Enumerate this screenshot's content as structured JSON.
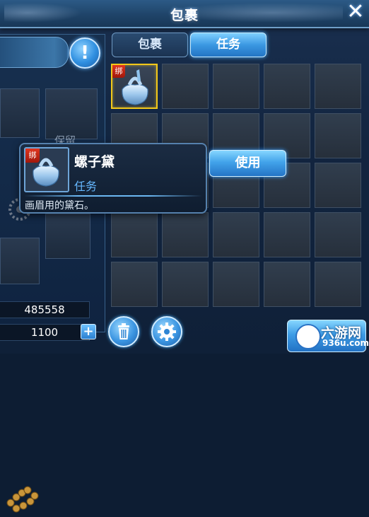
{
  "window": {
    "title": "包裹",
    "close_glyph": "✕"
  },
  "tabs": [
    {
      "label": "包裹",
      "active": false
    },
    {
      "label": "任务",
      "active": true
    }
  ],
  "left_panel": {
    "info_glyph": "!",
    "equip_label": "保留",
    "gold": "485558",
    "gems": "1100",
    "add_glyph": "+"
  },
  "inventory": {
    "rows": 5,
    "cols": 5,
    "items": [
      {
        "slot": 0,
        "name": "螺子黛",
        "bind_badge": "绑",
        "selected": true
      }
    ]
  },
  "tooltip": {
    "bind_badge": "绑",
    "item_name": "螺子黛",
    "item_category": "任务",
    "description": "画眉用的黛石。",
    "use_button": "使用"
  },
  "watermark": {
    "brand": "六游网",
    "domain": "936u.com"
  },
  "colors": {
    "accent": "#3b98e2",
    "selected_border": "#f2c81a",
    "bind_badge": "#d02a16",
    "category_text": "#66b8ff"
  }
}
